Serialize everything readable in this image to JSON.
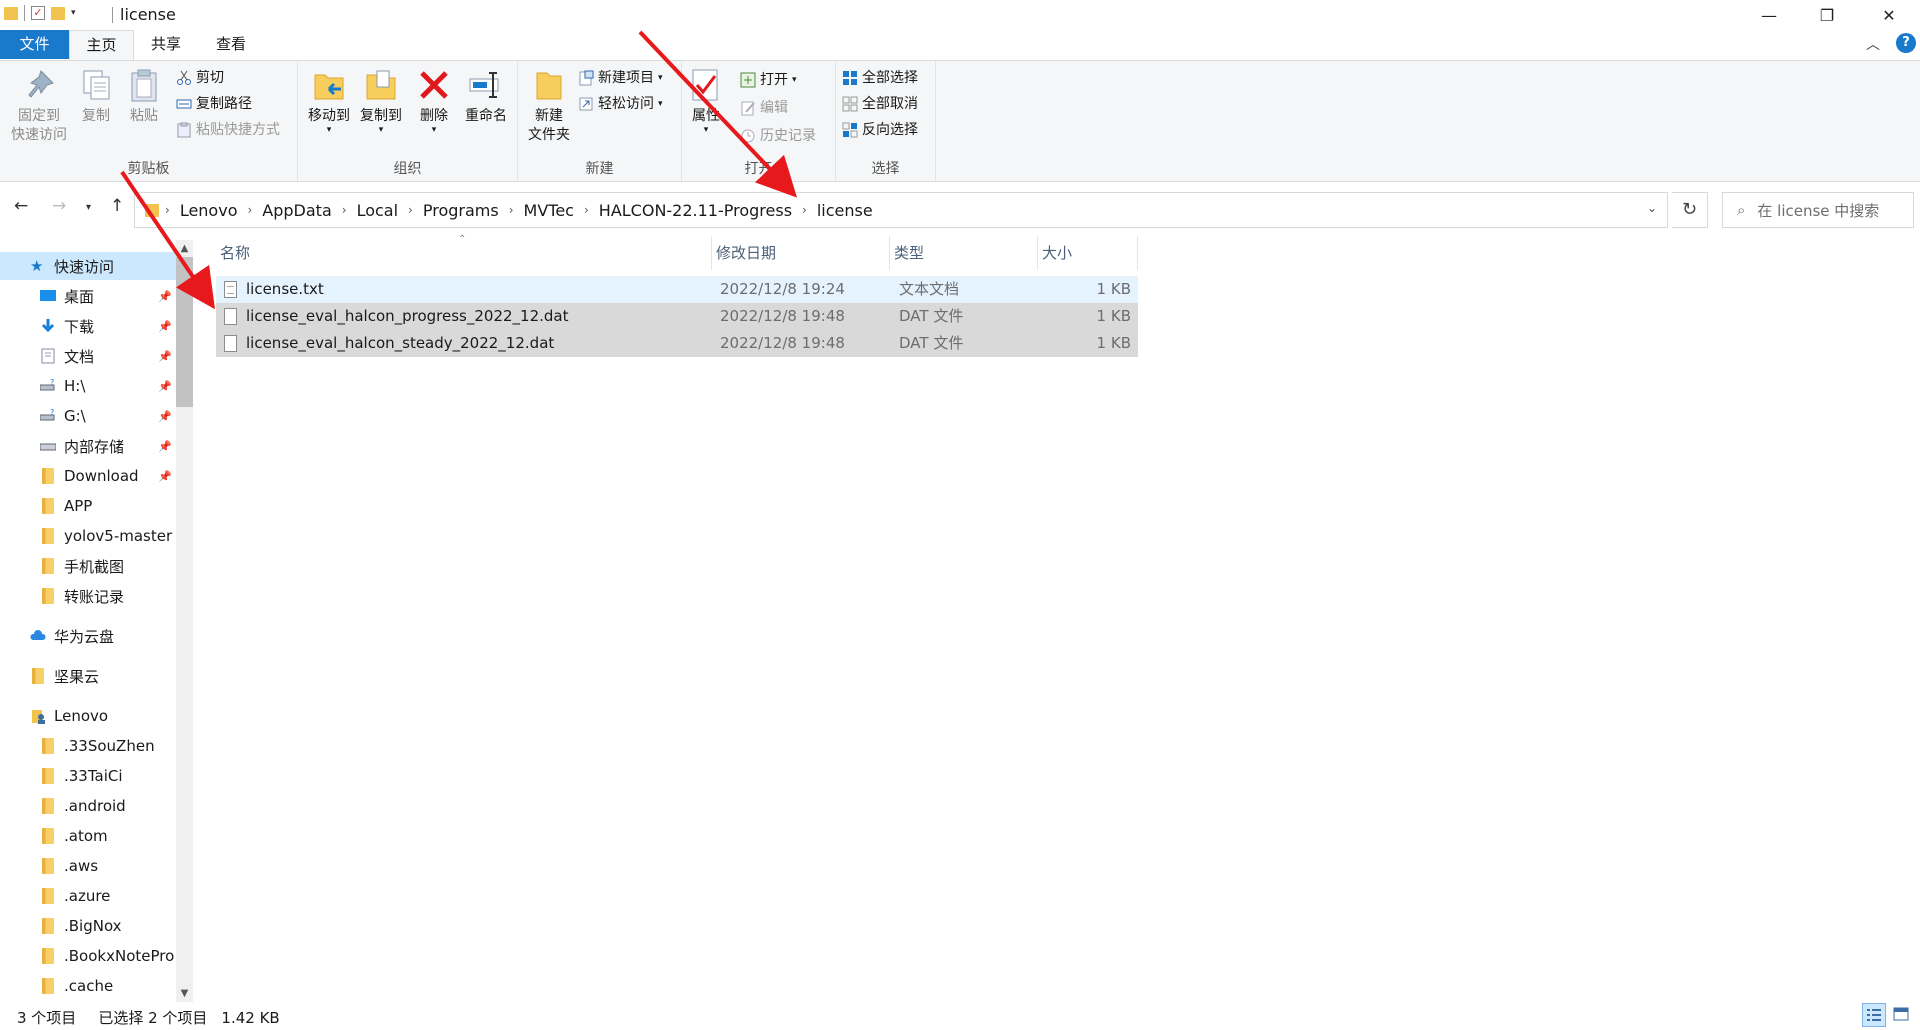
{
  "window": {
    "title": "license",
    "minimize": "—",
    "maximize": "❐",
    "close": "✕"
  },
  "tabs": {
    "file": "文件",
    "home": "主页",
    "share": "共享",
    "view": "查看"
  },
  "ribbon": {
    "clipboard": {
      "label": "剪贴板",
      "pin_line1": "固定到",
      "pin_line2": "快速访问",
      "copy": "复制",
      "paste": "粘贴",
      "cut": "剪切",
      "copy_path": "复制路径",
      "paste_shortcut": "粘贴快捷方式"
    },
    "organize": {
      "label": "组织",
      "move_to": "移动到",
      "copy_to": "复制到",
      "delete": "删除",
      "rename": "重命名"
    },
    "new": {
      "label": "新建",
      "new_folder_line1": "新建",
      "new_folder_line2": "文件夹",
      "new_item": "新建项目",
      "easy_access": "轻松访问"
    },
    "open": {
      "label": "打开",
      "properties": "属性",
      "open": "打开",
      "edit": "编辑",
      "history": "历史记录"
    },
    "select": {
      "label": "选择",
      "select_all": "全部选择",
      "select_none": "全部取消",
      "invert": "反向选择"
    }
  },
  "address": {
    "crumbs": [
      "Lenovo",
      "AppData",
      "Local",
      "Programs",
      "MVTec",
      "HALCON-22.11-Progress",
      "license"
    ],
    "search_placeholder": "在 license 中搜索"
  },
  "nav": {
    "quick_access": "快速访问",
    "pinned": [
      {
        "label": "桌面",
        "icon": "desktop-icon"
      },
      {
        "label": "下载",
        "icon": "download-icon"
      },
      {
        "label": "文档",
        "icon": "document-icon"
      },
      {
        "label": "H:\\",
        "icon": "drive-icon"
      },
      {
        "label": "G:\\",
        "icon": "drive-icon"
      },
      {
        "label": "内部存储",
        "icon": "storage-icon"
      },
      {
        "label": "Download",
        "icon": "folder-icon"
      }
    ],
    "folders": [
      "APP",
      "yolov5-master",
      "手机截图",
      "转账记录"
    ],
    "huawei": "华为云盘",
    "jianguo": "坚果云",
    "lenovo": "Lenovo",
    "lenovo_children": [
      ".33SouZhen",
      ".33TaiCi",
      ".android",
      ".atom",
      ".aws",
      ".azure",
      ".BigNox",
      ".BookxNotePro",
      ".cache"
    ]
  },
  "columns": {
    "name": "名称",
    "date": "修改日期",
    "type": "类型",
    "size": "大小"
  },
  "files": [
    {
      "name": "license.txt",
      "date": "2022/12/8 19:24",
      "type": "文本文档",
      "size": "1 KB"
    },
    {
      "name": "license_eval_halcon_progress_2022_12.dat",
      "date": "2022/12/8 19:48",
      "type": "DAT 文件",
      "size": "1 KB"
    },
    {
      "name": "license_eval_halcon_steady_2022_12.dat",
      "date": "2022/12/8 19:48",
      "type": "DAT 文件",
      "size": "1 KB"
    }
  ],
  "status": {
    "count": "3 个项目",
    "selected": "已选择 2 个项目",
    "size": "1.42 KB"
  },
  "colors": {
    "accent": "#1979ca",
    "selection": "#cce8ff",
    "arrow": "#e8191c"
  }
}
